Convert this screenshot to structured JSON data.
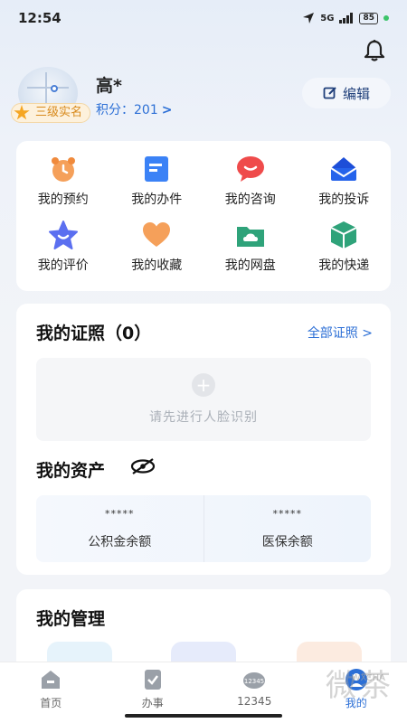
{
  "status": {
    "time": "12:54",
    "signal": "5G",
    "battery": "85"
  },
  "profile": {
    "name": "高*",
    "level": "三级实名",
    "points_label": "积分：",
    "points_value": "201",
    "edit_label": "编辑"
  },
  "quick_actions": [
    {
      "label": "我的预约",
      "icon": "alarm-clock-icon",
      "color": "#f5a05a"
    },
    {
      "label": "我的办件",
      "icon": "document-icon",
      "color": "#3b82f6"
    },
    {
      "label": "我的咨询",
      "icon": "chat-bubble-icon",
      "color": "#ef4b4b"
    },
    {
      "label": "我的投诉",
      "icon": "envelope-icon",
      "color": "#2563eb"
    },
    {
      "label": "我的评价",
      "icon": "star-icon",
      "color": "#5b6ff0"
    },
    {
      "label": "我的收藏",
      "icon": "heart-icon",
      "color": "#f5a05a"
    },
    {
      "label": "我的网盘",
      "icon": "folder-cloud-icon",
      "color": "#2fa37a"
    },
    {
      "label": "我的快递",
      "icon": "package-icon",
      "color": "#2fa37a"
    }
  ],
  "certificates": {
    "title": "我的证照（0）",
    "all_link": "全部证照",
    "face_prompt": "请先进行人脸识别"
  },
  "assets": {
    "title": "我的资产",
    "items": [
      {
        "value": "*****",
        "label": "公积金余额"
      },
      {
        "value": "*****",
        "label": "医保余额"
      }
    ]
  },
  "management": {
    "title": "我的管理"
  },
  "tabs": [
    {
      "label": "首页",
      "icon": "home-icon",
      "active": false
    },
    {
      "label": "办事",
      "icon": "task-icon",
      "active": false
    },
    {
      "label": "12345",
      "icon": "hotline-icon",
      "active": false
    },
    {
      "label": "我的",
      "icon": "profile-icon",
      "active": true
    }
  ],
  "watermark": {
    "text": "微茶",
    "small": "WXCHA"
  },
  "colors": {
    "accent": "#2c6fd6",
    "badge": "#d88a1c"
  }
}
